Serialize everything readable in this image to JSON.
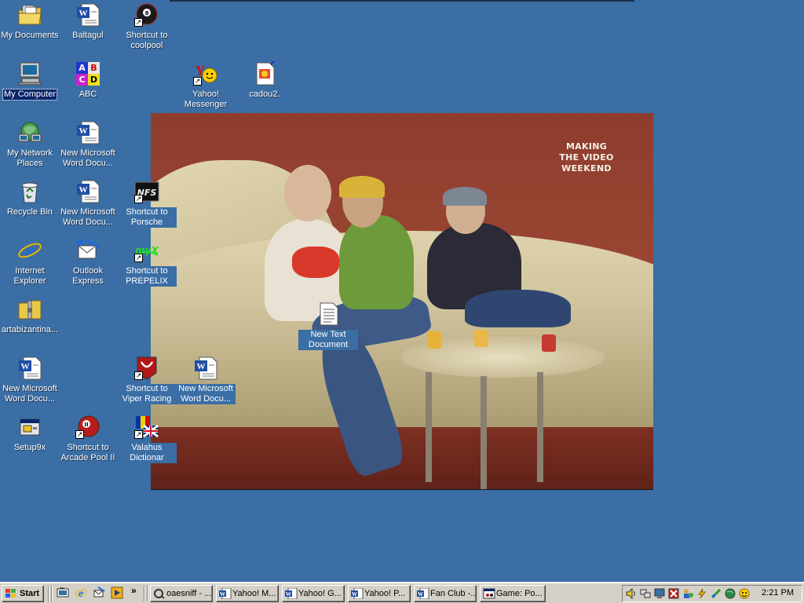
{
  "desktop": {
    "background_color": "#3a6ea5",
    "icons": [
      {
        "id": "my-documents",
        "label": "My Documents",
        "icon": "folder-documents-icon"
      },
      {
        "id": "baltagul",
        "label": "Baltagul",
        "icon": "word-document-icon"
      },
      {
        "id": "coolpool",
        "label": "Shortcut to coolpool",
        "icon": "eight-ball-icon"
      },
      {
        "id": "my-computer",
        "label": "My Computer",
        "icon": "computer-icon"
      },
      {
        "id": "abc",
        "label": "ABC",
        "icon": "abc-blocks-icon"
      },
      {
        "id": "yahoo-messenger",
        "label": "Yahoo! Messenger",
        "icon": "smiley-icon"
      },
      {
        "id": "cadou2",
        "label": "cadou2.",
        "icon": "image-file-icon"
      },
      {
        "id": "my-network-places",
        "label": "My Network Places",
        "icon": "network-icon"
      },
      {
        "id": "word-doc-1",
        "label": "New Microsoft Word Docu...",
        "icon": "word-document-icon"
      },
      {
        "id": "recycle-bin",
        "label": "Recycle Bin",
        "icon": "recycle-bin-icon"
      },
      {
        "id": "word-doc-2",
        "label": "New Microsoft Word Docu...",
        "icon": "word-document-icon"
      },
      {
        "id": "porsche",
        "label": "Shortcut to Porsche",
        "icon": "nfs-game-icon"
      },
      {
        "id": "internet-explorer",
        "label": "Internet Explorer",
        "icon": "internet-explorer-icon"
      },
      {
        "id": "outlook-express",
        "label": "Outlook Express",
        "icon": "outlook-express-icon"
      },
      {
        "id": "prepelix",
        "label": "Shortcut to PREPELIX",
        "icon": "prepelix-icon"
      },
      {
        "id": "artabizantina",
        "label": "artabizantina...",
        "icon": "zip-folder-icon"
      },
      {
        "id": "new-text-document",
        "label": "New Text Document",
        "icon": "text-document-icon"
      },
      {
        "id": "word-doc-3",
        "label": "New Microsoft Word Docu...",
        "icon": "word-document-icon"
      },
      {
        "id": "viper-racing",
        "label": "Shortcut to Viper Racing",
        "icon": "viper-game-icon"
      },
      {
        "id": "word-doc-4",
        "label": "New Microsoft Word Docu...",
        "icon": "word-document-icon"
      },
      {
        "id": "setup9x",
        "label": "Setup9x",
        "icon": "setup-installer-icon"
      },
      {
        "id": "arcade-pool",
        "label": "Shortcut to Arcade Pool II",
        "icon": "pool-ball-icon"
      },
      {
        "id": "valahus",
        "label": "Valahus Dictionar",
        "icon": "flags-dictionary-icon"
      }
    ]
  },
  "wallpaper": {
    "caption_lines": [
      "MAKING",
      "THE VIDEO",
      "WEEKEND"
    ]
  },
  "taskbar": {
    "start_label": "Start",
    "chevron": "»",
    "quick_launch": [
      {
        "icon": "show-desktop-icon"
      },
      {
        "icon": "internet-explorer-icon"
      },
      {
        "icon": "outlook-express-icon"
      },
      {
        "icon": "media-player-icon"
      }
    ],
    "tasks": [
      {
        "label": "oaesniff - ...",
        "icon": "sniffer-icon"
      },
      {
        "label": "Yahoo! M...",
        "icon": "word-document-icon"
      },
      {
        "label": "Yahoo! G...",
        "icon": "word-document-icon"
      },
      {
        "label": "Yahoo! P...",
        "icon": "word-document-icon"
      },
      {
        "label": "Fan Club -...",
        "icon": "word-document-icon"
      },
      {
        "label": "Game: Po...",
        "icon": "game-window-icon"
      }
    ],
    "tray": {
      "clock": "2:21 PM"
    }
  }
}
